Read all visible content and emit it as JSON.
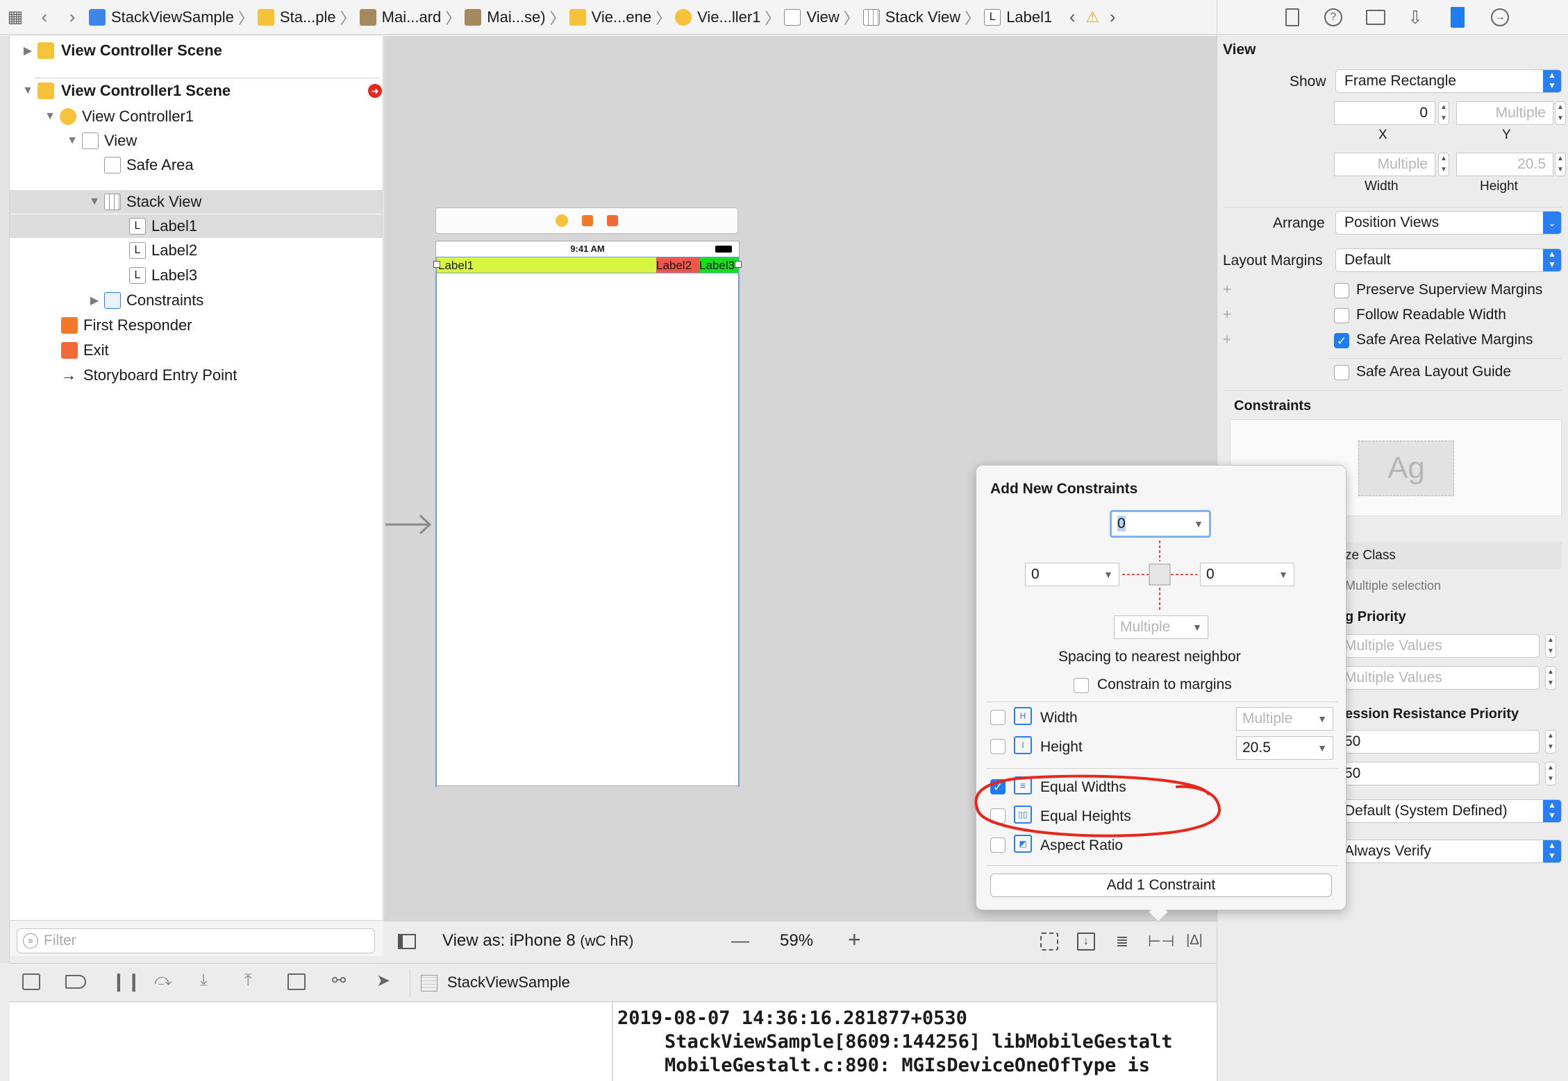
{
  "jumpbar": {
    "items": [
      "StackViewSample",
      "Sta...ple",
      "Mai...ard",
      "Mai...se)",
      "Vie...ene",
      "Vie...ller1",
      "View",
      "Stack View",
      "Label1"
    ]
  },
  "navigator": {
    "scene1": "View Controller Scene",
    "scene2": "View Controller1 Scene",
    "vc": "View Controller1",
    "view": "View",
    "safe_area": "Safe Area",
    "stack_view": "Stack View",
    "label1": "Label1",
    "label2": "Label2",
    "label3": "Label3",
    "constraints": "Constraints",
    "first_responder": "First Responder",
    "exit": "Exit",
    "entry": "Storyboard Entry Point",
    "filter_placeholder": "Filter"
  },
  "canvas": {
    "status_time": "9:41 AM",
    "label1": "Label1",
    "label2": "Label2",
    "label3": "Label3",
    "view_as": "View as: iPhone 8",
    "size_class": "(wC hR)",
    "zoom_out": "—",
    "zoom": "59%",
    "zoom_in": "+"
  },
  "popover": {
    "title": "Add New Constraints",
    "top": "0",
    "left": "0",
    "right": "0",
    "bottom": "Multiple",
    "spacing_label": "Spacing to nearest neighbor",
    "constrain_margins": "Constrain to margins",
    "width_label": "Width",
    "width_value": "Multiple",
    "height_label": "Height",
    "height_value": "20.5",
    "equal_widths": "Equal Widths",
    "equal_heights": "Equal Heights",
    "aspect_ratio": "Aspect Ratio",
    "add_button": "Add 1 Constraint"
  },
  "inspector": {
    "section": "View",
    "show_label": "Show",
    "show_value": "Frame Rectangle",
    "x_value": "0",
    "y_value": "Multiple",
    "x_label": "X",
    "y_label": "Y",
    "width_value": "Multiple",
    "height_value": "20.5",
    "width_label": "Width",
    "height_label": "Height",
    "arrange_label": "Arrange",
    "arrange_value": "Position Views",
    "margins_label": "Layout Margins",
    "margins_value": "Default",
    "preserve": "Preserve Superview Margins",
    "readable": "Follow Readable Width",
    "safe_rel": "Safe Area Relative Margins",
    "safe_guide": "Safe Area Layout Guide",
    "constraints_title": "Constraints",
    "ag": "Ag",
    "size_class": "ze Class",
    "multiple_selection": "Multiple selection",
    "hugging": "g Priority",
    "mv1": "Multiple Values",
    "mv2": "Multiple Values",
    "compression": "ession Resistance Priority",
    "cr1": "50",
    "cr2": "50",
    "intrinsic": "Default (System Defined)",
    "ambiguity": "Always Verify"
  },
  "debugbar": {
    "target": "StackViewSample"
  },
  "console": {
    "line1": "2019-08-07 14:36:16.281877+0530",
    "line2": "StackViewSample[8609:144256] libMobileGestalt",
    "line3": "MobileGestalt.c:890: MGIsDeviceOneOfType is"
  },
  "colors": {
    "accent": "#1f7cf4",
    "label1_bg": "#d8f542",
    "label2_bg": "#f0564a",
    "label3_bg": "#19e01f",
    "annotation": "#e8271c"
  }
}
